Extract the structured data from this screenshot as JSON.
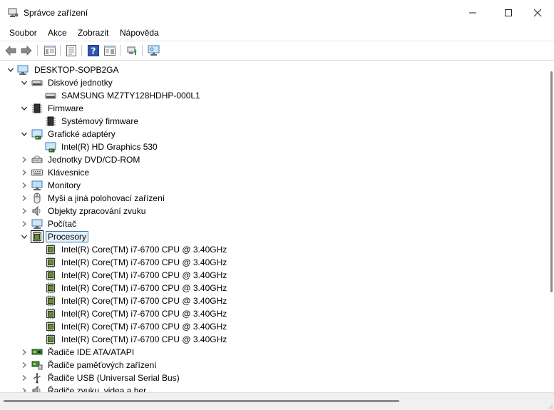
{
  "window": {
    "title": "Správce zařízení"
  },
  "menu": [
    "Soubor",
    "Akce",
    "Zobrazit",
    "Nápověda"
  ],
  "tree": {
    "root": "DESKTOP-SOPB2GA",
    "rows": [
      {
        "label": "Diskové jednotky",
        "level": 1,
        "expanded": true,
        "icon": "disk-drive-icon"
      },
      {
        "label": "SAMSUNG MZ7TY128HDHP-000L1",
        "level": 2,
        "icon": "disk-drive-icon"
      },
      {
        "label": "Firmware",
        "level": 1,
        "expanded": true,
        "icon": "firmware-chip-icon"
      },
      {
        "label": "Systémový firmware",
        "level": 2,
        "icon": "firmware-chip-icon"
      },
      {
        "label": "Grafické adaptéry",
        "level": 1,
        "expanded": true,
        "icon": "display-adapter-icon"
      },
      {
        "label": "Intel(R) HD Graphics 530",
        "level": 2,
        "icon": "display-adapter-icon"
      },
      {
        "label": "Jednotky DVD/CD-ROM",
        "level": 1,
        "expanded": false,
        "icon": "dvd-drive-icon"
      },
      {
        "label": "Klávesnice",
        "level": 1,
        "expanded": false,
        "icon": "keyboard-icon"
      },
      {
        "label": "Monitory",
        "level": 1,
        "expanded": false,
        "icon": "monitor-icon"
      },
      {
        "label": "Myši a jiná polohovací zařízení",
        "level": 1,
        "expanded": false,
        "icon": "mouse-icon"
      },
      {
        "label": "Objekty zpracování zvuku",
        "level": 1,
        "expanded": false,
        "icon": "speaker-icon"
      },
      {
        "label": "Počítač",
        "level": 1,
        "expanded": false,
        "icon": "computer-icon"
      },
      {
        "label": "Procesory",
        "level": 1,
        "expanded": true,
        "selected": true,
        "icon": "processor-icon"
      },
      {
        "label": "Intel(R) Core(TM) i7-6700 CPU @ 3.40GHz",
        "level": 2,
        "icon": "processor-icon"
      },
      {
        "label": "Intel(R) Core(TM) i7-6700 CPU @ 3.40GHz",
        "level": 2,
        "icon": "processor-icon"
      },
      {
        "label": "Intel(R) Core(TM) i7-6700 CPU @ 3.40GHz",
        "level": 2,
        "icon": "processor-icon"
      },
      {
        "label": "Intel(R) Core(TM) i7-6700 CPU @ 3.40GHz",
        "level": 2,
        "icon": "processor-icon"
      },
      {
        "label": "Intel(R) Core(TM) i7-6700 CPU @ 3.40GHz",
        "level": 2,
        "icon": "processor-icon"
      },
      {
        "label": "Intel(R) Core(TM) i7-6700 CPU @ 3.40GHz",
        "level": 2,
        "icon": "processor-icon"
      },
      {
        "label": "Intel(R) Core(TM) i7-6700 CPU @ 3.40GHz",
        "level": 2,
        "icon": "processor-icon"
      },
      {
        "label": "Intel(R) Core(TM) i7-6700 CPU @ 3.40GHz",
        "level": 2,
        "icon": "processor-icon"
      },
      {
        "label": "Řadiče IDE ATA/ATAPI",
        "level": 1,
        "expanded": false,
        "icon": "ide-controller-icon"
      },
      {
        "label": "Řadiče paměťových zařízení",
        "level": 1,
        "expanded": false,
        "icon": "storage-controller-icon"
      },
      {
        "label": "Řadiče USB (Universal Serial Bus)",
        "level": 1,
        "expanded": false,
        "icon": "usb-icon"
      },
      {
        "label": "Řadiče zvuku, videa a her",
        "level": 1,
        "expanded": false,
        "icon": "sound-controller-icon"
      }
    ]
  },
  "colors": {
    "selection_bg": "#e5f1fb",
    "selection_border": "#3c7fb1"
  }
}
